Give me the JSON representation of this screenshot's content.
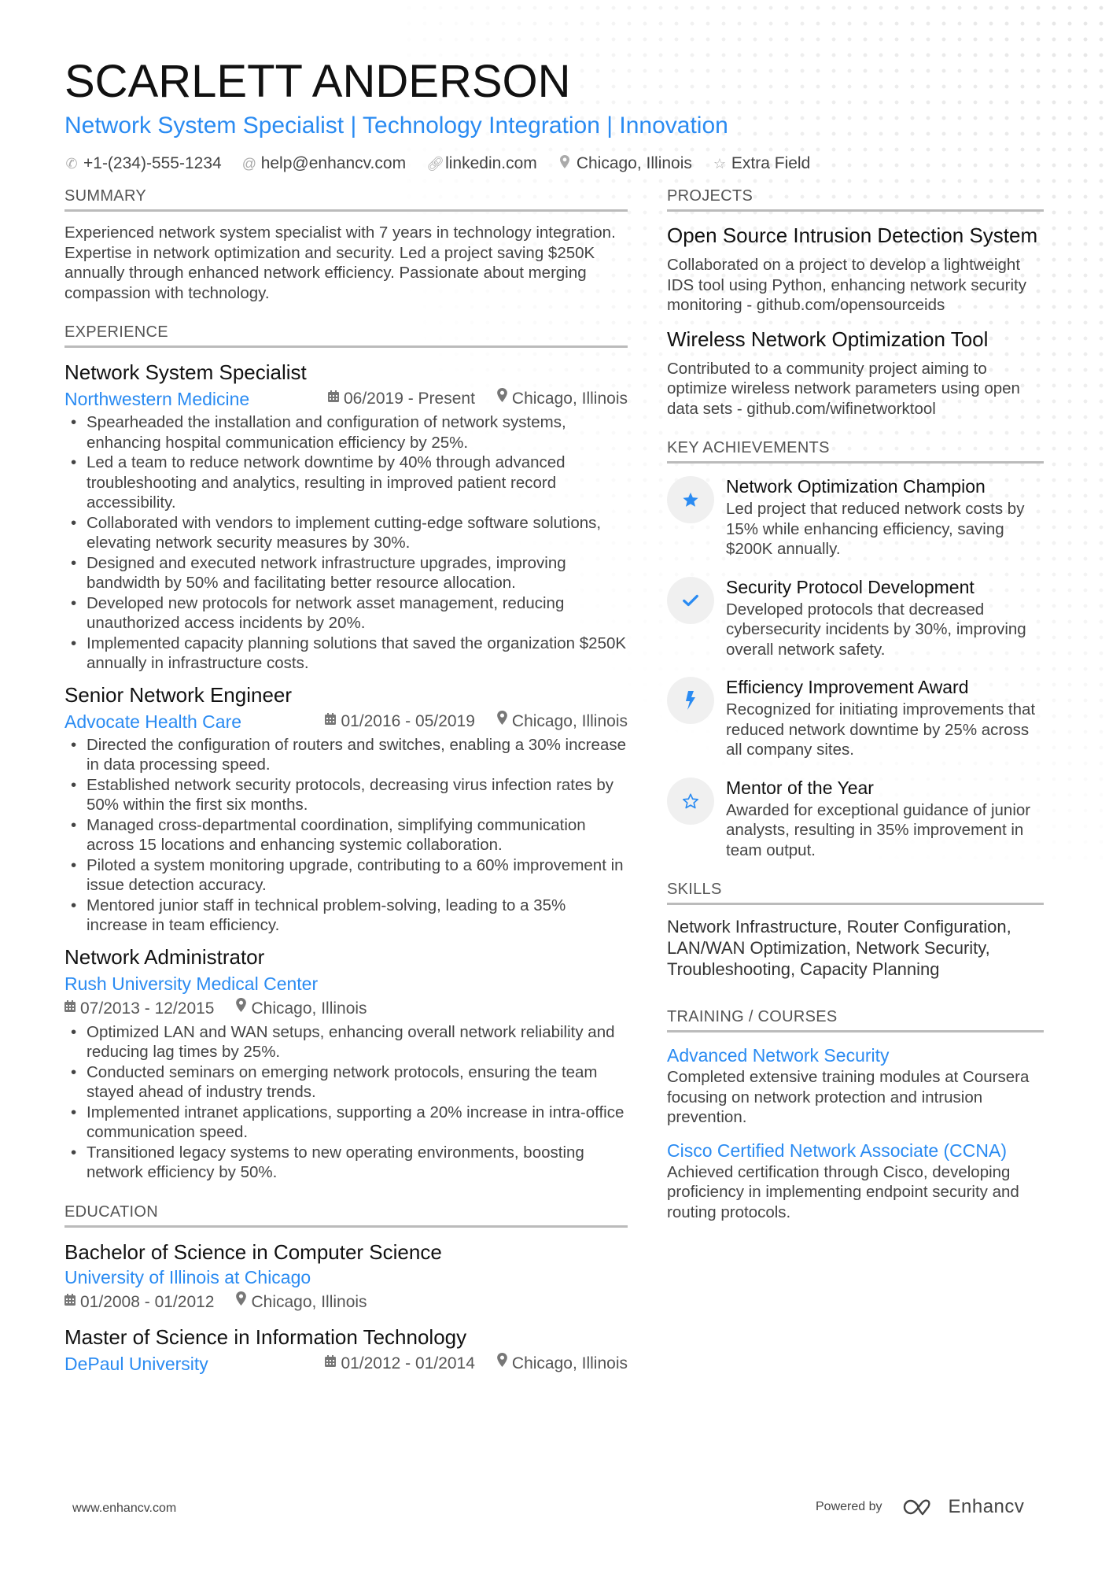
{
  "header": {
    "name": "SCARLETT ANDERSON",
    "title": "Network System Specialist | Technology Integration | Innovation",
    "contacts": [
      {
        "icon": "phone-icon",
        "text": "+1-(234)-555-1234"
      },
      {
        "icon": "at-icon",
        "text": "help@enhancv.com"
      },
      {
        "icon": "link-icon",
        "text": "linkedin.com"
      },
      {
        "icon": "location-icon",
        "text": "Chicago, Illinois"
      },
      {
        "icon": "star-icon",
        "text": "Extra Field"
      }
    ]
  },
  "summary": {
    "heading": "SUMMARY",
    "text": "Experienced network system specialist with 7 years in technology integration. Expertise in network optimization and security. Led a project saving $250K annually through enhanced network efficiency. Passionate about merging compassion with technology."
  },
  "experience": {
    "heading": "EXPERIENCE",
    "jobs": [
      {
        "title": "Network System Specialist",
        "company": "Northwestern Medicine",
        "dates": "06/2019 - Present",
        "location": "Chicago, Illinois",
        "bullets": [
          "Spearheaded the installation and configuration of network systems, enhancing hospital communication efficiency by 25%.",
          "Led a team to reduce network downtime by 40% through advanced troubleshooting and analytics, resulting in improved patient record accessibility.",
          "Collaborated with vendors to implement cutting-edge software solutions, elevating network security measures by 30%.",
          "Designed and executed network infrastructure upgrades, improving bandwidth by 50% and facilitating better resource allocation.",
          "Developed new protocols for network asset management, reducing unauthorized access incidents by 20%.",
          "Implemented capacity planning solutions that saved the organization $250K annually in infrastructure costs."
        ]
      },
      {
        "title": "Senior Network Engineer",
        "company": "Advocate Health Care",
        "dates": "01/2016 - 05/2019",
        "location": "Chicago, Illinois",
        "bullets": [
          "Directed the configuration of routers and switches, enabling a 30% increase in data processing speed.",
          "Established network security protocols, decreasing virus infection rates by 50% within the first six months.",
          "Managed cross-departmental coordination, simplifying communication across 15 locations and enhancing systemic collaboration.",
          "Piloted a system monitoring upgrade, contributing to a 60% improvement in issue detection accuracy.",
          "Mentored junior staff in technical problem-solving, leading to a 35% increase in team efficiency."
        ]
      },
      {
        "title": "Network Administrator",
        "company": "Rush University Medical Center",
        "dates": "07/2013 - 12/2015",
        "location": "Chicago, Illinois",
        "bullets": [
          "Optimized LAN and WAN setups, enhancing overall network reliability and reducing lag times by 25%.",
          "Conducted seminars on emerging network protocols, ensuring the team stayed ahead of industry trends.",
          "Implemented intranet applications, supporting a 20% increase in intra-office communication speed.",
          "Transitioned legacy systems to new operating environments, boosting network efficiency by 50%."
        ]
      }
    ]
  },
  "education": {
    "heading": "EDUCATION",
    "items": [
      {
        "degree": "Bachelor of Science in Computer Science",
        "school": "University of Illinois at Chicago",
        "dates": "01/2008 - 01/2012",
        "location": "Chicago, Illinois"
      },
      {
        "degree": "Master of Science in Information Technology",
        "school": "DePaul University",
        "dates": "01/2012 - 01/2014",
        "location": "Chicago, Illinois"
      }
    ]
  },
  "projects": {
    "heading": "PROJECTS",
    "items": [
      {
        "title": "Open Source Intrusion Detection System",
        "desc": "Collaborated on a project to develop a lightweight IDS tool using Python, enhancing network security monitoring - github.com/opensourceids"
      },
      {
        "title": "Wireless Network Optimization Tool",
        "desc": "Contributed to a community project aiming to optimize wireless network parameters using open data sets - github.com/wifinetworktool"
      }
    ]
  },
  "achievements": {
    "heading": "KEY ACHIEVEMENTS",
    "items": [
      {
        "icon": "star-filled-icon",
        "title": "Network Optimization Champion",
        "desc": "Led project that reduced network costs by 15% while enhancing efficiency, saving $200K annually."
      },
      {
        "icon": "check-icon",
        "title": "Security Protocol Development",
        "desc": "Developed protocols that decreased cybersecurity incidents by 30%, improving overall network safety."
      },
      {
        "icon": "bolt-icon",
        "title": "Efficiency Improvement Award",
        "desc": "Recognized for initiating improvements that reduced network downtime by 25% across all company sites."
      },
      {
        "icon": "star-outline-icon",
        "title": "Mentor of the Year",
        "desc": "Awarded for exceptional guidance of junior analysts, resulting in 35% improvement in team output."
      }
    ]
  },
  "skills": {
    "heading": "SKILLS",
    "text": "Network Infrastructure, Router Configuration, LAN/WAN Optimization, Network Security, Troubleshooting, Capacity Planning"
  },
  "training": {
    "heading": "TRAINING / COURSES",
    "items": [
      {
        "title": "Advanced Network Security",
        "desc": "Completed extensive training modules at Coursera focusing on network protection and intrusion prevention."
      },
      {
        "title": "Cisco Certified Network Associate (CCNA)",
        "desc": "Achieved certification through Cisco, developing proficiency in implementing endpoint security and routing protocols."
      }
    ]
  },
  "footer": {
    "website": "www.enhancv.com",
    "powered_by": "Powered by",
    "brand": "Enhancv"
  },
  "colors": {
    "accent": "#2a8bf2",
    "text": "#444444",
    "heading_rule": "#bbbbbb"
  }
}
